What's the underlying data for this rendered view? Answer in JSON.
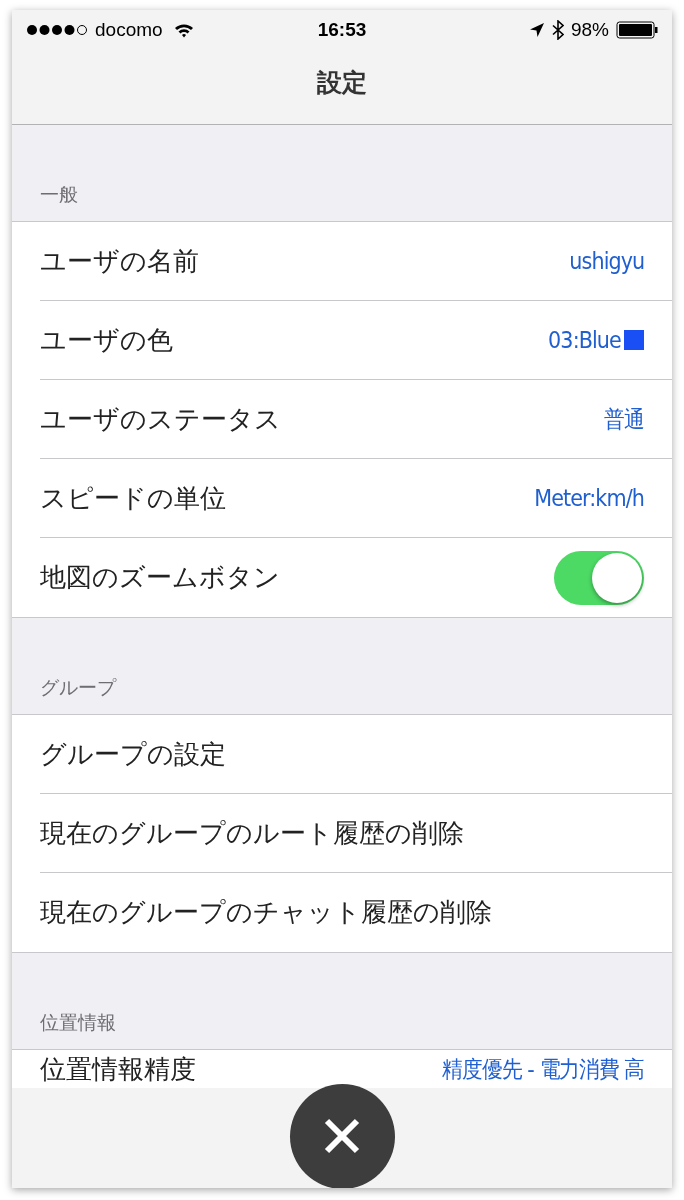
{
  "status_bar": {
    "carrier": "docomo",
    "time": "16:53",
    "battery": "98%"
  },
  "nav": {
    "title": "設定"
  },
  "sections": [
    {
      "header": "一般",
      "rows": [
        {
          "kind": "value",
          "label": "ユーザの名前",
          "value": "ushigyu"
        },
        {
          "kind": "color",
          "label": "ユーザの色",
          "value": "03:Blue",
          "color": "#1a4ff5"
        },
        {
          "kind": "value",
          "label": "ユーザのステータス",
          "value": "普通"
        },
        {
          "kind": "value",
          "label": "スピードの単位",
          "value": "Meter:km/h"
        },
        {
          "kind": "toggle",
          "label": "地図のズームボタン",
          "on": true
        }
      ]
    },
    {
      "header": "グループ",
      "rows": [
        {
          "kind": "link",
          "label": "グループの設定"
        },
        {
          "kind": "link",
          "label": "現在のグループのルート履歴の削除"
        },
        {
          "kind": "link",
          "label": "現在のグループのチャット履歴の削除"
        }
      ]
    },
    {
      "header": "位置情報",
      "rows": [
        {
          "kind": "value",
          "label": "位置情報精度",
          "value": "精度優先 - 電力消費 高"
        }
      ]
    }
  ]
}
